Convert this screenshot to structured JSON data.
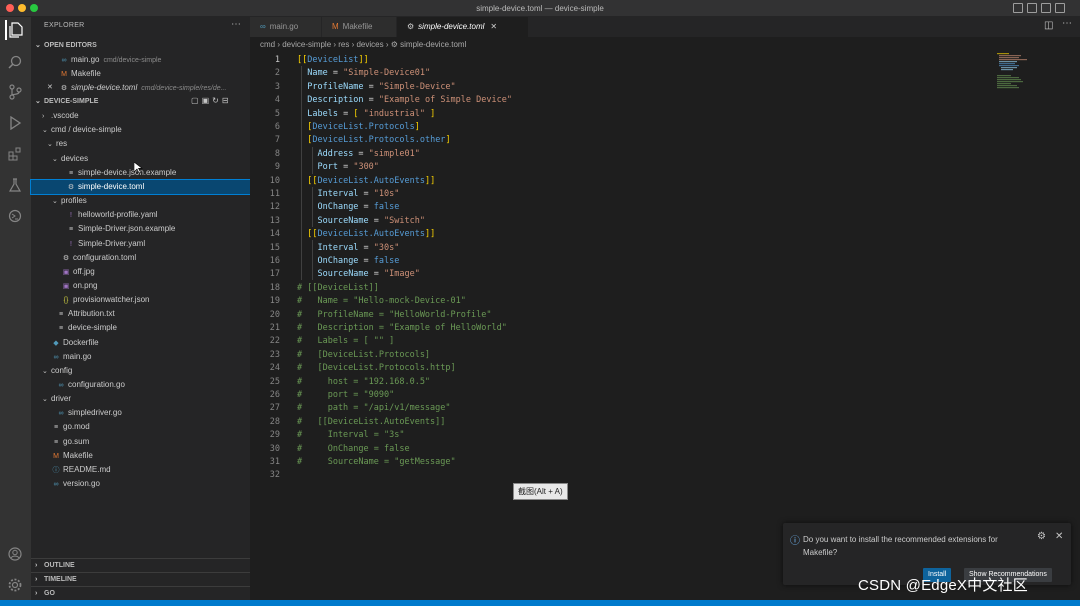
{
  "window": {
    "title": "simple-device.toml — device-simple"
  },
  "explorer": {
    "header": "EXPLORER",
    "open_editors_label": "OPEN EDITORS",
    "open_editors": [
      {
        "icon": "go-file-icon",
        "glyph": "∞",
        "color": "#519aba",
        "name": "main.go",
        "desc": "cmd/device-simple"
      },
      {
        "icon": "makefile-icon",
        "glyph": "M",
        "color": "#e37933",
        "name": "Makefile",
        "desc": ""
      },
      {
        "icon": "gear-file-icon",
        "glyph": "⚙",
        "color": "#cccccc",
        "name": "simple-device.toml",
        "desc": "cmd/device-simple/res/de..."
      }
    ],
    "folder_label": "DEVICE-SIMPLE",
    "tree": [
      {
        "indent": 1,
        "chev": "›",
        "icon": "",
        "glyph": "",
        "color": "#cccccc",
        "name": ".vscode"
      },
      {
        "indent": 1,
        "chev": "⌄",
        "icon": "",
        "glyph": "",
        "color": "#cccccc",
        "name": "cmd / device-simple"
      },
      {
        "indent": 2,
        "chev": "⌄",
        "icon": "",
        "glyph": "",
        "color": "#cccccc",
        "name": "res"
      },
      {
        "indent": 3,
        "chev": "⌄",
        "icon": "",
        "glyph": "",
        "color": "#cccccc",
        "name": "devices"
      },
      {
        "indent": 4,
        "chev": "",
        "icon": "lines-file-icon",
        "glyph": "≡",
        "color": "#cccccc",
        "name": "simple-device.json.example"
      },
      {
        "indent": 4,
        "chev": "",
        "icon": "gear-file-icon",
        "glyph": "⚙",
        "color": "#cccccc",
        "name": "simple-device.toml",
        "selected": true
      },
      {
        "indent": 3,
        "chev": "⌄",
        "icon": "",
        "glyph": "",
        "color": "#cccccc",
        "name": "profiles"
      },
      {
        "indent": 4,
        "chev": "",
        "icon": "yaml-file-icon",
        "glyph": "!",
        "color": "#a074c4",
        "name": "helloworld-profile.yaml"
      },
      {
        "indent": 4,
        "chev": "",
        "icon": "lines-file-icon",
        "glyph": "≡",
        "color": "#cccccc",
        "name": "Simple-Driver.json.example"
      },
      {
        "indent": 4,
        "chev": "",
        "icon": "yaml-file-icon",
        "glyph": "!",
        "color": "#a074c4",
        "name": "Simple-Driver.yaml"
      },
      {
        "indent": 3,
        "chev": "",
        "icon": "gear-file-icon",
        "glyph": "⚙",
        "color": "#cccccc",
        "name": "configuration.toml"
      },
      {
        "indent": 3,
        "chev": "",
        "icon": "image-file-icon",
        "glyph": "▣",
        "color": "#a074c4",
        "name": "off.jpg"
      },
      {
        "indent": 3,
        "chev": "",
        "icon": "image-file-icon",
        "glyph": "▣",
        "color": "#a074c4",
        "name": "on.png"
      },
      {
        "indent": 3,
        "chev": "",
        "icon": "json-file-icon",
        "glyph": "{}",
        "color": "#cbcb41",
        "name": "provisionwatcher.json"
      },
      {
        "indent": 2,
        "chev": "",
        "icon": "lines-file-icon",
        "glyph": "≡",
        "color": "#cccccc",
        "name": "Attribution.txt"
      },
      {
        "indent": 2,
        "chev": "",
        "icon": "lines-file-icon",
        "glyph": "≡",
        "color": "#cccccc",
        "name": "device-simple"
      },
      {
        "indent": 1,
        "chev": "",
        "icon": "docker-file-icon",
        "glyph": "◆",
        "color": "#519aba",
        "name": "Dockerfile"
      },
      {
        "indent": 1,
        "chev": "",
        "icon": "go-file-icon",
        "glyph": "∞",
        "color": "#519aba",
        "name": "main.go"
      },
      {
        "indent": 1,
        "chev": "⌄",
        "icon": "",
        "glyph": "",
        "color": "#cccccc",
        "name": "config"
      },
      {
        "indent": 2,
        "chev": "",
        "icon": "go-file-icon",
        "glyph": "∞",
        "color": "#519aba",
        "name": "configuration.go"
      },
      {
        "indent": 1,
        "chev": "⌄",
        "icon": "",
        "glyph": "",
        "color": "#cccccc",
        "name": "driver"
      },
      {
        "indent": 2,
        "chev": "",
        "icon": "go-file-icon",
        "glyph": "∞",
        "color": "#519aba",
        "name": "simpledriver.go"
      },
      {
        "indent": 1,
        "chev": "",
        "icon": "lines-file-icon",
        "glyph": "≡",
        "color": "#cccccc",
        "name": "go.mod"
      },
      {
        "indent": 1,
        "chev": "",
        "icon": "lines-file-icon",
        "glyph": "≡",
        "color": "#cccccc",
        "name": "go.sum"
      },
      {
        "indent": 1,
        "chev": "",
        "icon": "makefile-icon",
        "glyph": "M",
        "color": "#e37933",
        "name": "Makefile"
      },
      {
        "indent": 1,
        "chev": "",
        "icon": "info-file-icon",
        "glyph": "ⓘ",
        "color": "#519aba",
        "name": "README.md"
      },
      {
        "indent": 1,
        "chev": "",
        "icon": "go-file-icon",
        "glyph": "∞",
        "color": "#519aba",
        "name": "version.go"
      }
    ],
    "panels": [
      "OUTLINE",
      "TIMELINE",
      "GO"
    ]
  },
  "tabs": [
    {
      "icon": "go-file-icon",
      "glyph": "∞",
      "color": "#519aba",
      "label": "main.go",
      "active": false
    },
    {
      "icon": "makefile-icon",
      "glyph": "M",
      "color": "#e37933",
      "label": "Makefile",
      "active": false
    },
    {
      "icon": "gear-file-icon",
      "glyph": "⚙",
      "color": "#cccccc",
      "label": "simple-device.toml",
      "active": true
    }
  ],
  "breadcrumb": [
    "cmd",
    "device-simple",
    "res",
    "devices",
    "simple-device.toml"
  ],
  "editor": {
    "current_line": 1,
    "lines": [
      [
        [
          "br",
          "[["
        ],
        [
          "sec",
          "DeviceList"
        ],
        [
          "br",
          "]]"
        ]
      ],
      [
        [
          "t",
          "  "
        ],
        [
          "key",
          "Name"
        ],
        [
          "t",
          " = "
        ],
        [
          "str",
          "\"Simple-Device01\""
        ]
      ],
      [
        [
          "t",
          "  "
        ],
        [
          "key",
          "ProfileName"
        ],
        [
          "t",
          " = "
        ],
        [
          "str",
          "\"Simple-Device\""
        ]
      ],
      [
        [
          "t",
          "  "
        ],
        [
          "key",
          "Description"
        ],
        [
          "t",
          " = "
        ],
        [
          "str",
          "\"Example of Simple Device\""
        ]
      ],
      [
        [
          "t",
          "  "
        ],
        [
          "key",
          "Labels"
        ],
        [
          "t",
          " = "
        ],
        [
          "br",
          "[ "
        ],
        [
          "str",
          "\"industrial\""
        ],
        [
          "br",
          " ]"
        ]
      ],
      [
        [
          "t",
          "  "
        ],
        [
          "br",
          "["
        ],
        [
          "sec",
          "DeviceList.Protocols"
        ],
        [
          "br",
          "]"
        ]
      ],
      [
        [
          "t",
          "  "
        ],
        [
          "br",
          "["
        ],
        [
          "sec",
          "DeviceList.Protocols.other"
        ],
        [
          "br",
          "]"
        ]
      ],
      [
        [
          "t",
          "    "
        ],
        [
          "key",
          "Address"
        ],
        [
          "t",
          " = "
        ],
        [
          "str",
          "\"simple01\""
        ]
      ],
      [
        [
          "t",
          "    "
        ],
        [
          "key",
          "Port"
        ],
        [
          "t",
          " = "
        ],
        [
          "str",
          "\"300\""
        ]
      ],
      [
        [
          "t",
          "  "
        ],
        [
          "br",
          "[["
        ],
        [
          "sec",
          "DeviceList.AutoEvents"
        ],
        [
          "br",
          "]]"
        ]
      ],
      [
        [
          "t",
          "    "
        ],
        [
          "key",
          "Interval"
        ],
        [
          "t",
          " = "
        ],
        [
          "str",
          "\"10s\""
        ]
      ],
      [
        [
          "t",
          "    "
        ],
        [
          "key",
          "OnChange"
        ],
        [
          "t",
          " = "
        ],
        [
          "kw",
          "false"
        ]
      ],
      [
        [
          "t",
          "    "
        ],
        [
          "key",
          "SourceName"
        ],
        [
          "t",
          " = "
        ],
        [
          "str",
          "\"Switch\""
        ]
      ],
      [
        [
          "t",
          "  "
        ],
        [
          "br",
          "[["
        ],
        [
          "sec",
          "DeviceList.AutoEvents"
        ],
        [
          "br",
          "]]"
        ]
      ],
      [
        [
          "t",
          "    "
        ],
        [
          "key",
          "Interval"
        ],
        [
          "t",
          " = "
        ],
        [
          "str",
          "\"30s\""
        ]
      ],
      [
        [
          "t",
          "    "
        ],
        [
          "key",
          "OnChange"
        ],
        [
          "t",
          " = "
        ],
        [
          "kw",
          "false"
        ]
      ],
      [
        [
          "t",
          "    "
        ],
        [
          "key",
          "SourceName"
        ],
        [
          "t",
          " = "
        ],
        [
          "str",
          "\"Image\""
        ]
      ],
      [
        [
          "com",
          "# [[DeviceList]]"
        ]
      ],
      [
        [
          "com",
          "#   Name = \"Hello-mock-Device-01\""
        ]
      ],
      [
        [
          "com",
          "#   ProfileName = \"HelloWorld-Profile\""
        ]
      ],
      [
        [
          "com",
          "#   Description = \"Example of HelloWorld\""
        ]
      ],
      [
        [
          "com",
          "#   Labels = [ \"\" ]"
        ]
      ],
      [
        [
          "com",
          "#   [DeviceList.Protocols]"
        ]
      ],
      [
        [
          "com",
          "#   [DeviceList.Protocols.http]"
        ]
      ],
      [
        [
          "com",
          "#     host = \"192.168.0.5\""
        ]
      ],
      [
        [
          "com",
          "#     port = \"9090\""
        ]
      ],
      [
        [
          "com",
          "#     path = \"/api/v1/message\""
        ]
      ],
      [
        [
          "com",
          "#   [[DeviceList.AutoEvents]]"
        ]
      ],
      [
        [
          "com",
          "#     Interval = \"3s\""
        ]
      ],
      [
        [
          "com",
          "#     OnChange = false"
        ]
      ],
      [
        [
          "com",
          "#     SourceName = \"getMessage\""
        ]
      ],
      [
        [
          "t",
          ""
        ]
      ]
    ]
  },
  "tooltip": "截图(Alt + A)",
  "notification": {
    "message": "Do you want to install the recommended extensions for Makefile?",
    "install_label": "Install",
    "show_label": "Show Recommendations"
  },
  "watermark": "CSDN @EdgeX中文社区",
  "colors": {
    "accent": "#007acc",
    "selection": "#094771",
    "bracket": "#ffd700",
    "string": "#ce9178",
    "key": "#9cdcfe",
    "comment": "#6a9955"
  }
}
